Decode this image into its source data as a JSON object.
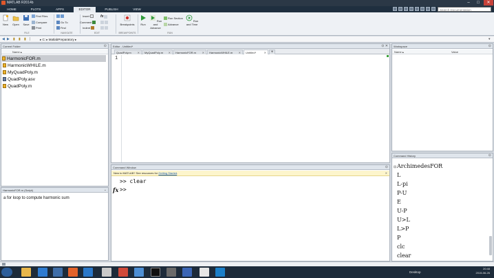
{
  "window": {
    "title": "MATLAB R2014b",
    "min_glyph": "–",
    "max_glyph": "□",
    "close_glyph": "✕"
  },
  "ribbon_tabs": [
    {
      "label": "HOME",
      "active": false
    },
    {
      "label": "PLOTS",
      "active": false
    },
    {
      "label": "APPS",
      "active": false
    },
    {
      "label": "EDITOR",
      "active": true
    },
    {
      "label": "PUBLISH",
      "active": false
    },
    {
      "label": "VIEW",
      "active": false
    }
  ],
  "search": {
    "placeholder": "Search Documentation"
  },
  "ribbon": {
    "new": "New",
    "open": "Open",
    "save": "Save",
    "find_files": "Find Files",
    "compare": "Compare",
    "print": "Print",
    "go_to": "Go To",
    "find": "Find",
    "insert": "Insert",
    "comment": "Comment",
    "indent": "Indent",
    "breakpoints": "Breakpoints",
    "run": "Run",
    "run_and_advance": "Run and Advance",
    "run_section": "Run Section",
    "advance": "Advance",
    "run_and_time": "Run and Time",
    "sections": {
      "file": "FILE",
      "navigate": "NAVIGATE",
      "edit": "EDIT",
      "breakpoints": "BREAKPOINTS",
      "run": "RUN"
    }
  },
  "address": {
    "path": "▸ C: ▸ MatlabPreparatory ▸"
  },
  "current_folder": {
    "title": "Current Folder",
    "column_name": "Name ▴",
    "files": [
      {
        "name": "HarmonicFOR.m",
        "selected": true
      },
      {
        "name": "HarmonicWHILE.m",
        "selected": false
      },
      {
        "name": "MyQuadPoly.m",
        "selected": false
      },
      {
        "name": "QuadPoly.asv",
        "selected": false
      },
      {
        "name": "QuadPoly.m",
        "selected": false
      }
    ]
  },
  "details": {
    "title": "HarmonicFOR.m (Script)",
    "description": "a for loop to compute harmonic sum"
  },
  "editor": {
    "title": "Editor - Untitled*",
    "tabs": [
      {
        "label": "QuadPoly.m",
        "active": false
      },
      {
        "label": "MyQuadPoly.m",
        "active": false
      },
      {
        "label": "HarmonicFOR.m",
        "active": false
      },
      {
        "label": "HarmonicWHILE.m",
        "active": false
      },
      {
        "label": "Untitled*",
        "active": true
      }
    ],
    "add_tab": "+",
    "line_number": "1"
  },
  "command_window": {
    "title": "Command Window",
    "notice_text": "New to MATLAB? See resources for ",
    "notice_link": "Getting Started",
    "notice_end": ".",
    "line1_prompt": ">>",
    "line1_text": "clear",
    "fx_label": "fx",
    "line2_prompt": ">>"
  },
  "workspace": {
    "title": "Workspace",
    "col_name": "Name ▴",
    "col_value": "Value"
  },
  "command_history": {
    "title": "Command History",
    "items": [
      "ArchimedesFOR",
      "L",
      "L-pi",
      "P-U",
      "E",
      "U-P",
      "U>L",
      "L>P",
      "P",
      "clc",
      "clear"
    ]
  },
  "taskbar": {
    "desktop_label": "Desktop",
    "time": "20:48",
    "date": "2015-06-26"
  },
  "colors": {
    "titlebar": "#2b3846",
    "ribbon_tabs_bg": "#1f2f3f",
    "taskbar": "#1d2b3a",
    "selected_row": "#c9ccd1",
    "link": "#1a5fb4"
  }
}
